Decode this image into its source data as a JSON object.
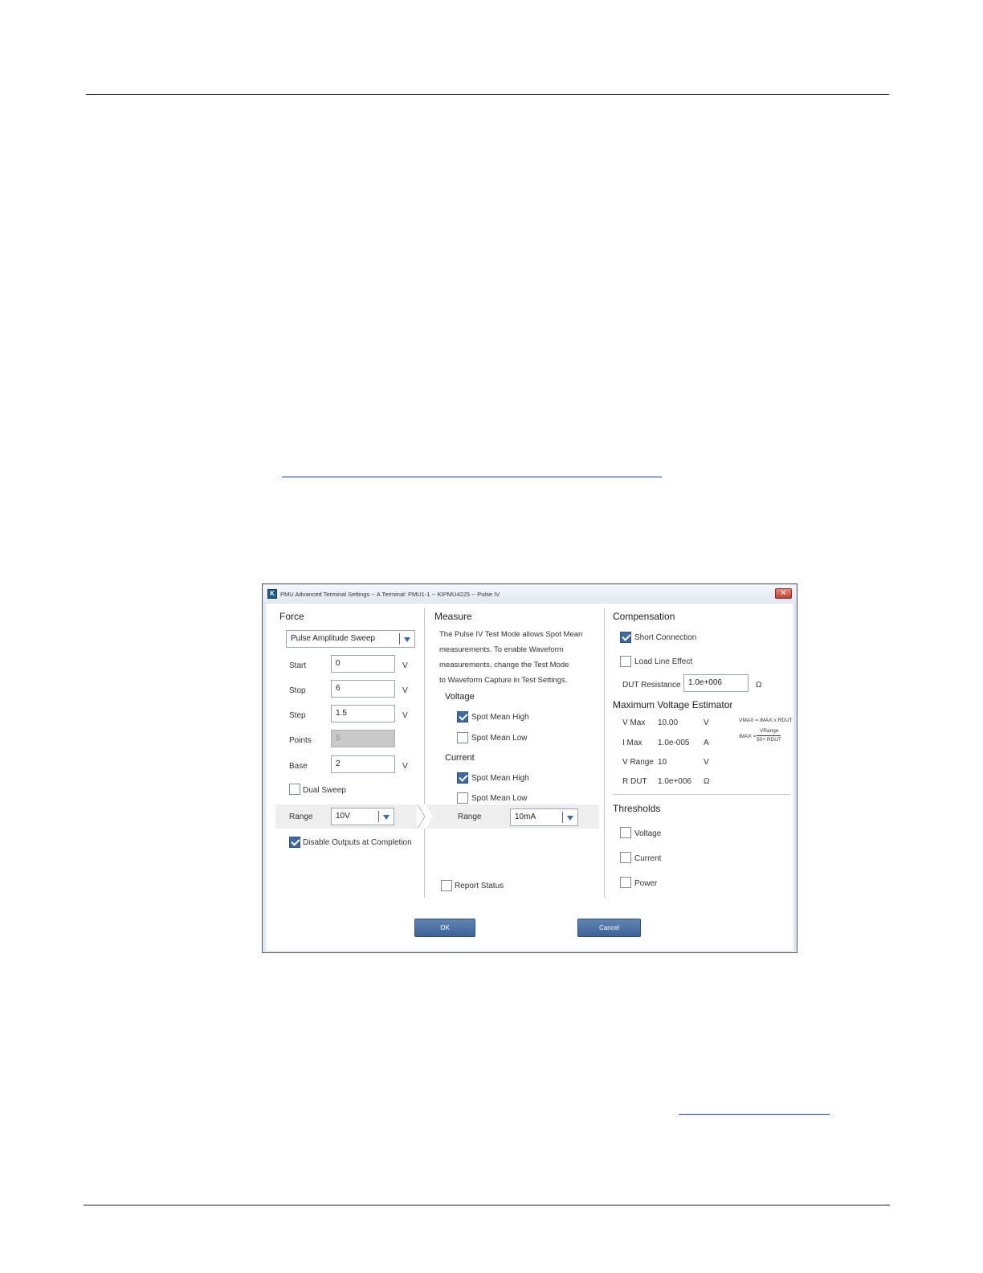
{
  "window": {
    "title": "PMU Advanced Terminal Settings -- A Terminal: PMU1-1 -- KIPMU4225 -- Pulse IV",
    "close_glyph": "✕",
    "app_icon_glyph": "K"
  },
  "force": {
    "header": "Force",
    "mode": "Pulse Amplitude Sweep",
    "start": {
      "label": "Start",
      "value": "0",
      "unit": "V"
    },
    "stop": {
      "label": "Stop",
      "value": "6",
      "unit": "V"
    },
    "step": {
      "label": "Step",
      "value": "1.5",
      "unit": "V"
    },
    "points": {
      "label": "Points",
      "value": "5"
    },
    "base": {
      "label": "Base",
      "value": "2",
      "unit": "V"
    },
    "dual_sweep": {
      "label": "Dual Sweep",
      "checked": false
    },
    "range": {
      "label": "Range",
      "value": "10V"
    },
    "disable_outputs": {
      "label": "Disable Outputs at Completion",
      "checked": true
    }
  },
  "measure": {
    "header": "Measure",
    "info_lines": [
      "The Pulse IV Test Mode allows Spot Mean",
      "measurements. To enable Waveform",
      "measurements, change the Test Mode",
      "to Waveform Capture in Test Settings."
    ],
    "voltage": {
      "header": "Voltage",
      "spot_mean_high": {
        "label": "Spot Mean High",
        "checked": true
      },
      "spot_mean_low": {
        "label": "Spot Mean Low",
        "checked": false
      }
    },
    "current": {
      "header": "Current",
      "spot_mean_high": {
        "label": "Spot Mean High",
        "checked": true
      },
      "spot_mean_low": {
        "label": "Spot Mean Low",
        "checked": false
      }
    },
    "range": {
      "label": "Range",
      "value": "10mA"
    },
    "report_status": {
      "label": "Report Status",
      "checked": false
    }
  },
  "compensation": {
    "header": "Compensation",
    "short_connection": {
      "label": "Short Connection",
      "checked": true
    },
    "load_line_effect": {
      "label": "Load Line Effect",
      "checked": false
    },
    "dut_resistance": {
      "label": "DUT Resistance",
      "value": "1.0e+006",
      "unit": "Ω"
    }
  },
  "estimator": {
    "header": "Maximum Voltage Estimator",
    "rows": [
      {
        "label": "V Max",
        "value": "10.00",
        "unit": "V"
      },
      {
        "label": "I  Max",
        "value": "1.0e-005",
        "unit": "A"
      },
      {
        "label": "V Range",
        "value": "10",
        "unit": "V"
      },
      {
        "label": "R DUT",
        "value": "1.0e+006",
        "unit": "Ω"
      }
    ],
    "formula1": "VMAX = IMAX x RDUT",
    "formula2_lhs": "IMAX =",
    "formula2_num": "VRange",
    "formula2_den": "50+ RDUT"
  },
  "thresholds": {
    "header": "Thresholds",
    "voltage": {
      "label": "Voltage",
      "checked": false
    },
    "current": {
      "label": "Current",
      "checked": false
    },
    "power": {
      "label": "Power",
      "checked": false
    }
  },
  "buttons": {
    "ok": "OK",
    "cancel": "Cancel"
  }
}
